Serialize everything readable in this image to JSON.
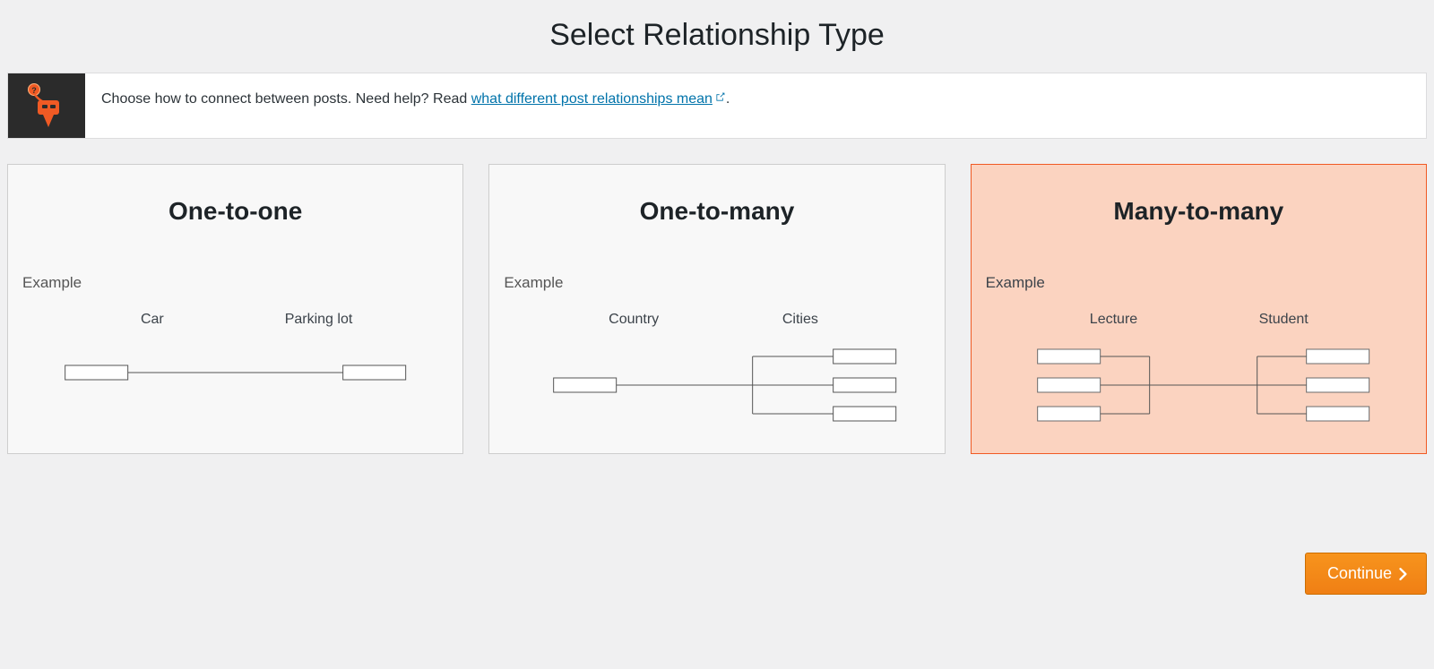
{
  "title": "Select Relationship Type",
  "info": {
    "text_prefix": "Choose how to connect between posts. Need help? Read ",
    "link_text": "what different post relationships mean",
    "text_suffix": "."
  },
  "cards": [
    {
      "id": "one-to-one",
      "title": "One-to-one",
      "example_heading": "Example",
      "left_label": "Car",
      "right_label": "Parking lot",
      "selected": false
    },
    {
      "id": "one-to-many",
      "title": "One-to-many",
      "example_heading": "Example",
      "left_label": "Country",
      "right_label": "Cities",
      "selected": false
    },
    {
      "id": "many-to-many",
      "title": "Many-to-many",
      "example_heading": "Example",
      "left_label": "Lecture",
      "right_label": "Student",
      "selected": true
    }
  ],
  "continue_label": "Continue",
  "colors": {
    "accent": "#f05a24",
    "accent_bg": "#fbd3c0",
    "link": "#0073aa",
    "button_bg": "#f7941d"
  }
}
